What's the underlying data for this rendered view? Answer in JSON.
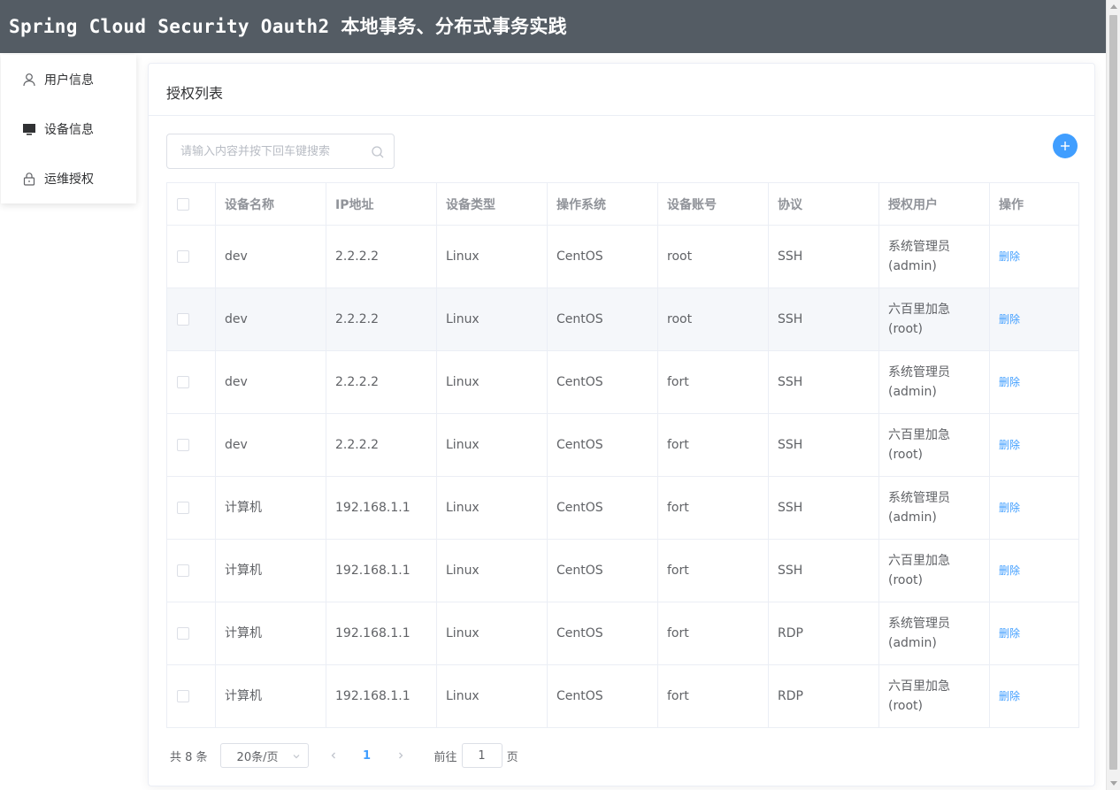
{
  "header": {
    "title": "Spring Cloud Security Oauth2 本地事务、分布式事务实践"
  },
  "sidebar": {
    "items": [
      {
        "label": "用户信息",
        "icon": "user-icon"
      },
      {
        "label": "设备信息",
        "icon": "monitor-icon"
      },
      {
        "label": "运维授权",
        "icon": "lock-icon"
      }
    ]
  },
  "card": {
    "title": "授权列表"
  },
  "search": {
    "placeholder": "请输入内容并按下回车键搜索",
    "value": ""
  },
  "table": {
    "headers": [
      "设备名称",
      "IP地址",
      "设备类型",
      "操作系统",
      "设备账号",
      "协议",
      "授权用户",
      "操作"
    ],
    "rows": [
      {
        "name": "dev",
        "ip": "2.2.2.2",
        "type": "Linux",
        "os": "CentOS",
        "account": "root",
        "protocol": "SSH",
        "user": "系统管理员(admin)",
        "action": "删除"
      },
      {
        "name": "dev",
        "ip": "2.2.2.2",
        "type": "Linux",
        "os": "CentOS",
        "account": "root",
        "protocol": "SSH",
        "user": "六百里加急(root)",
        "action": "删除"
      },
      {
        "name": "dev",
        "ip": "2.2.2.2",
        "type": "Linux",
        "os": "CentOS",
        "account": "fort",
        "protocol": "SSH",
        "user": "系统管理员(admin)",
        "action": "删除"
      },
      {
        "name": "dev",
        "ip": "2.2.2.2",
        "type": "Linux",
        "os": "CentOS",
        "account": "fort",
        "protocol": "SSH",
        "user": "六百里加急(root)",
        "action": "删除"
      },
      {
        "name": "计算机",
        "ip": "192.168.1.1",
        "type": "Linux",
        "os": "CentOS",
        "account": "fort",
        "protocol": "SSH",
        "user": "系统管理员(admin)",
        "action": "删除"
      },
      {
        "name": "计算机",
        "ip": "192.168.1.1",
        "type": "Linux",
        "os": "CentOS",
        "account": "fort",
        "protocol": "SSH",
        "user": "六百里加急(root)",
        "action": "删除"
      },
      {
        "name": "计算机",
        "ip": "192.168.1.1",
        "type": "Linux",
        "os": "CentOS",
        "account": "fort",
        "protocol": "RDP",
        "user": "系统管理员(admin)",
        "action": "删除"
      },
      {
        "name": "计算机",
        "ip": "192.168.1.1",
        "type": "Linux",
        "os": "CentOS",
        "account": "fort",
        "protocol": "RDP",
        "user": "六百里加急(root)",
        "action": "删除"
      }
    ]
  },
  "pagination": {
    "total_label": "共 8 条",
    "page_size_label": "20条/页",
    "current_page": "1",
    "goto_prefix": "前往",
    "goto_value": "1",
    "goto_suffix": "页"
  },
  "colors": {
    "header_bg": "#545c64",
    "accent": "#409eff",
    "border": "#ebeef5"
  }
}
